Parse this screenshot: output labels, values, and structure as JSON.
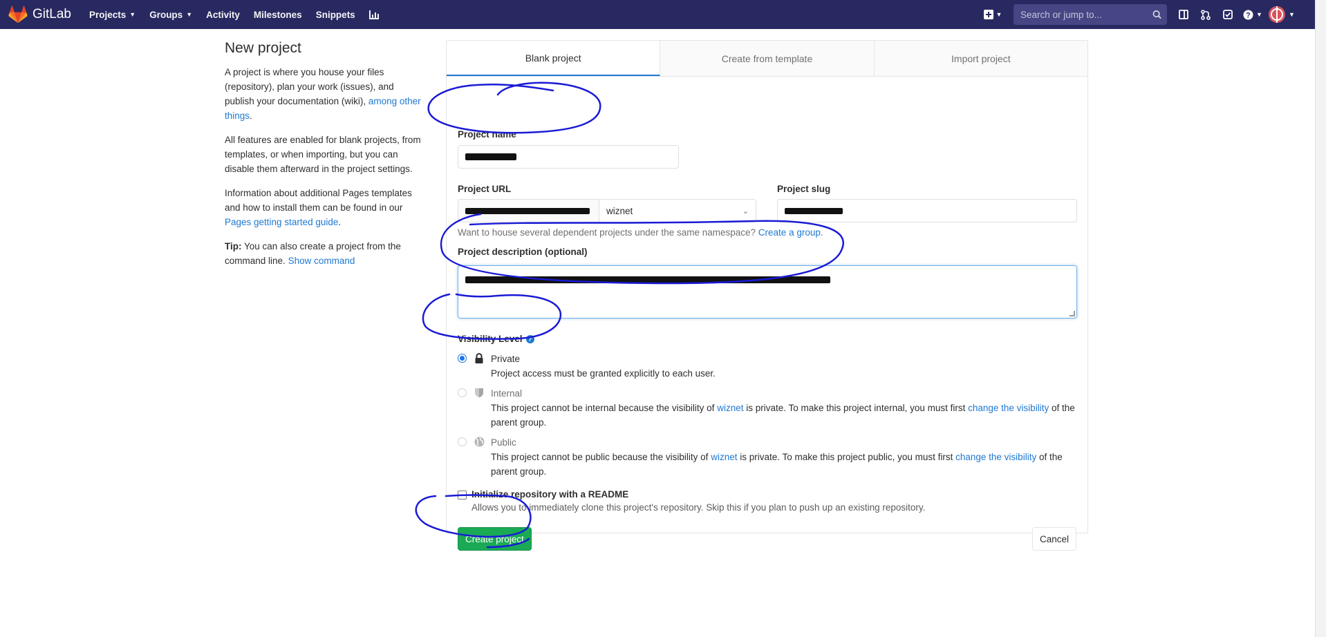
{
  "nav": {
    "brand": "GitLab",
    "links": [
      {
        "label": "Projects",
        "caret": true
      },
      {
        "label": "Groups",
        "caret": true
      },
      {
        "label": "Activity",
        "caret": false
      },
      {
        "label": "Milestones",
        "caret": false
      },
      {
        "label": "Snippets",
        "caret": false
      }
    ],
    "search_placeholder": "Search or jump to..."
  },
  "sidebar": {
    "title": "New project",
    "p1_text": "A project is where you house your files (repository), plan your work (issues), and publish your documentation (wiki),",
    "p1_link": "among other things",
    "p1_end": ".",
    "p2": "All features are enabled for blank projects, from templates, or when importing, but you can disable them afterward in the project settings.",
    "p3_text": "Information about additional Pages templates and how to install them can be found in our",
    "p3_link": "Pages getting started guide",
    "p3_end": ".",
    "tip_label": "Tip:",
    "tip_text": "You can also create a project from the command line.",
    "tip_link": "Show command"
  },
  "tabs": [
    "Blank project",
    "Create from template",
    "Import project"
  ],
  "form": {
    "project_name_label": "Project name",
    "project_url_label": "Project URL",
    "namespace_value": "wiznet",
    "project_slug_label": "Project slug",
    "namespace_hint": "Want to house several dependent projects under the same namespace?",
    "namespace_hint_link": "Create a group.",
    "description_label": "Project description (optional)",
    "visibility_label": "Visibility Level",
    "private_title": "Private",
    "private_desc": "Project access must be granted explicitly to each user.",
    "internal_title": "Internal",
    "internal_desc_1": "This project cannot be internal because the visibility of",
    "internal_group_link": "wiznet",
    "internal_desc_2": "is private. To make this project internal, you must first",
    "internal_change_link": "change the visibility",
    "internal_desc_3": "of the parent group.",
    "public_title": "Public",
    "public_desc_1": "This project cannot be public because the visibility of",
    "public_group_link": "wiznet",
    "public_desc_2": "is private. To make this project public, you must first",
    "public_change_link": "change the visibility",
    "public_desc_3": "of the parent group.",
    "readme_label": "Initialize repository with a README",
    "readme_desc": "Allows you to immediately clone this project's repository. Skip this if you plan to push up an existing repository.",
    "create_button": "Create project",
    "cancel_button": "Cancel"
  },
  "colors": {
    "navbar": "#292961",
    "link": "#1f78d1",
    "success": "#1aaa55",
    "annotation_ink": "#1a1ad6"
  }
}
